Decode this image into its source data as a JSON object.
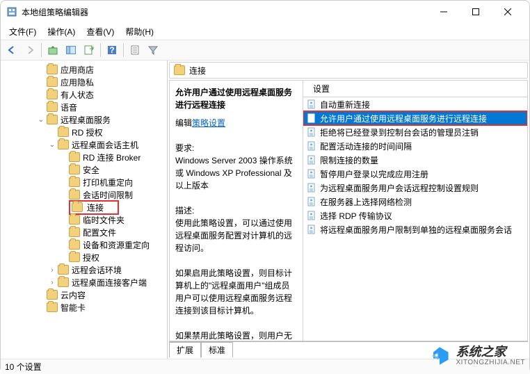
{
  "window": {
    "title": "本地组策略编辑器"
  },
  "menu": [
    "文件(F)",
    "操作(A)",
    "查看(V)",
    "帮助(H)"
  ],
  "tree": [
    {
      "label": "应用商店",
      "depth": 3,
      "exp": ""
    },
    {
      "label": "应用隐私",
      "depth": 3,
      "exp": ""
    },
    {
      "label": "有人状态",
      "depth": 3,
      "exp": ""
    },
    {
      "label": "语音",
      "depth": 3,
      "exp": ""
    },
    {
      "label": "远程桌面服务",
      "depth": 3,
      "exp": "v",
      "open": true
    },
    {
      "label": "RD 授权",
      "depth": 4,
      "exp": ""
    },
    {
      "label": "远程桌面会话主机",
      "depth": 4,
      "exp": "v",
      "open": true
    },
    {
      "label": "RD 连接 Broker",
      "depth": 5,
      "exp": ""
    },
    {
      "label": "安全",
      "depth": 5,
      "exp": ""
    },
    {
      "label": "打印机重定向",
      "depth": 5,
      "exp": ""
    },
    {
      "label": "会话时间限制",
      "depth": 5,
      "exp": ""
    },
    {
      "label": "连接",
      "depth": 5,
      "exp": "",
      "selected": true
    },
    {
      "label": "临时文件夹",
      "depth": 5,
      "exp": ""
    },
    {
      "label": "配置文件",
      "depth": 5,
      "exp": ""
    },
    {
      "label": "设备和资源重定向",
      "depth": 5,
      "exp": ""
    },
    {
      "label": "授权",
      "depth": 5,
      "exp": ""
    },
    {
      "label": "远程会话环境",
      "depth": 4,
      "exp": ">"
    },
    {
      "label": "远程桌面连接客户端",
      "depth": 4,
      "exp": ">"
    },
    {
      "label": "云内容",
      "depth": 3,
      "exp": ""
    },
    {
      "label": "智能卡",
      "depth": 3,
      "exp": ""
    }
  ],
  "mainHeader": "连接",
  "desc": {
    "title": "允许用户通过使用远程桌面服务进行远程连接",
    "editLabel": "编辑",
    "editLink": "策略设置",
    "reqLabel": "要求:",
    "reqText": "Windows Server 2003 操作系统或 Windows XP Professional 及以上版本",
    "descLabel": "描述:",
    "descText1": "使用此策略设置，可以通过使用远程桌面服务配置对计算机的远程访问。",
    "descText2": "如果启用此策略设置，则目标计算机上的\"远程桌面用户\"组成员用户可以使用远程桌面服务远程连接到该目标计算机。",
    "descText3": "如果禁用此策略设置，则用户无法"
  },
  "listHeader": "设置",
  "settings": [
    {
      "label": "自动重新连接"
    },
    {
      "label": "允许用户通过使用远程桌面服务进行远程连接",
      "hl": true
    },
    {
      "label": "拒绝将已经登录到控制台会话的管理员注销"
    },
    {
      "label": "配置活动连接的时间间隔"
    },
    {
      "label": "限制连接的数量"
    },
    {
      "label": "暂停用户登录以完成应用注册"
    },
    {
      "label": "为远程桌面服务用户会话远程控制设置规则"
    },
    {
      "label": "在服务器上选择网络检测"
    },
    {
      "label": "选择 RDP 传输协议"
    },
    {
      "label": "将远程桌面服务用户限制到单独的远程桌面服务会话"
    }
  ],
  "tabs": {
    "extended": "扩展",
    "standard": "标准"
  },
  "status": "10 个设置",
  "watermark": {
    "cn": "系统之家",
    "url": "XITONGZHIJIA.NET"
  }
}
